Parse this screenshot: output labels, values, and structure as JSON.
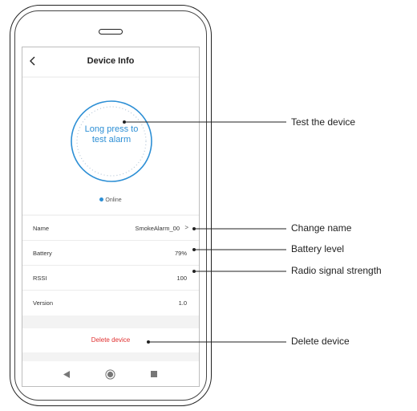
{
  "header": {
    "title": "Device Info",
    "back_icon": "chevron-left-icon"
  },
  "hero": {
    "test_label_line1": "Long press to",
    "test_label_line2": "test alarm",
    "status": "Online"
  },
  "list": {
    "rows": [
      {
        "label": "Name",
        "value": "SmokeAlarm_00",
        "chevron": ">"
      },
      {
        "label": "Battery",
        "value": "79%"
      },
      {
        "label": "RSSI",
        "value": "100"
      },
      {
        "label": "Version",
        "value": "1.0"
      }
    ]
  },
  "actions": {
    "delete_label": "Delete device"
  },
  "callouts": {
    "test": "Test the device",
    "name": "Change name",
    "battery": "Battery level",
    "rssi": "Radio signal strength",
    "delete": "Delete device"
  },
  "colors": {
    "accent": "#2d8fd5",
    "danger": "#e03131",
    "screen_bg": "#f3f3f3"
  }
}
